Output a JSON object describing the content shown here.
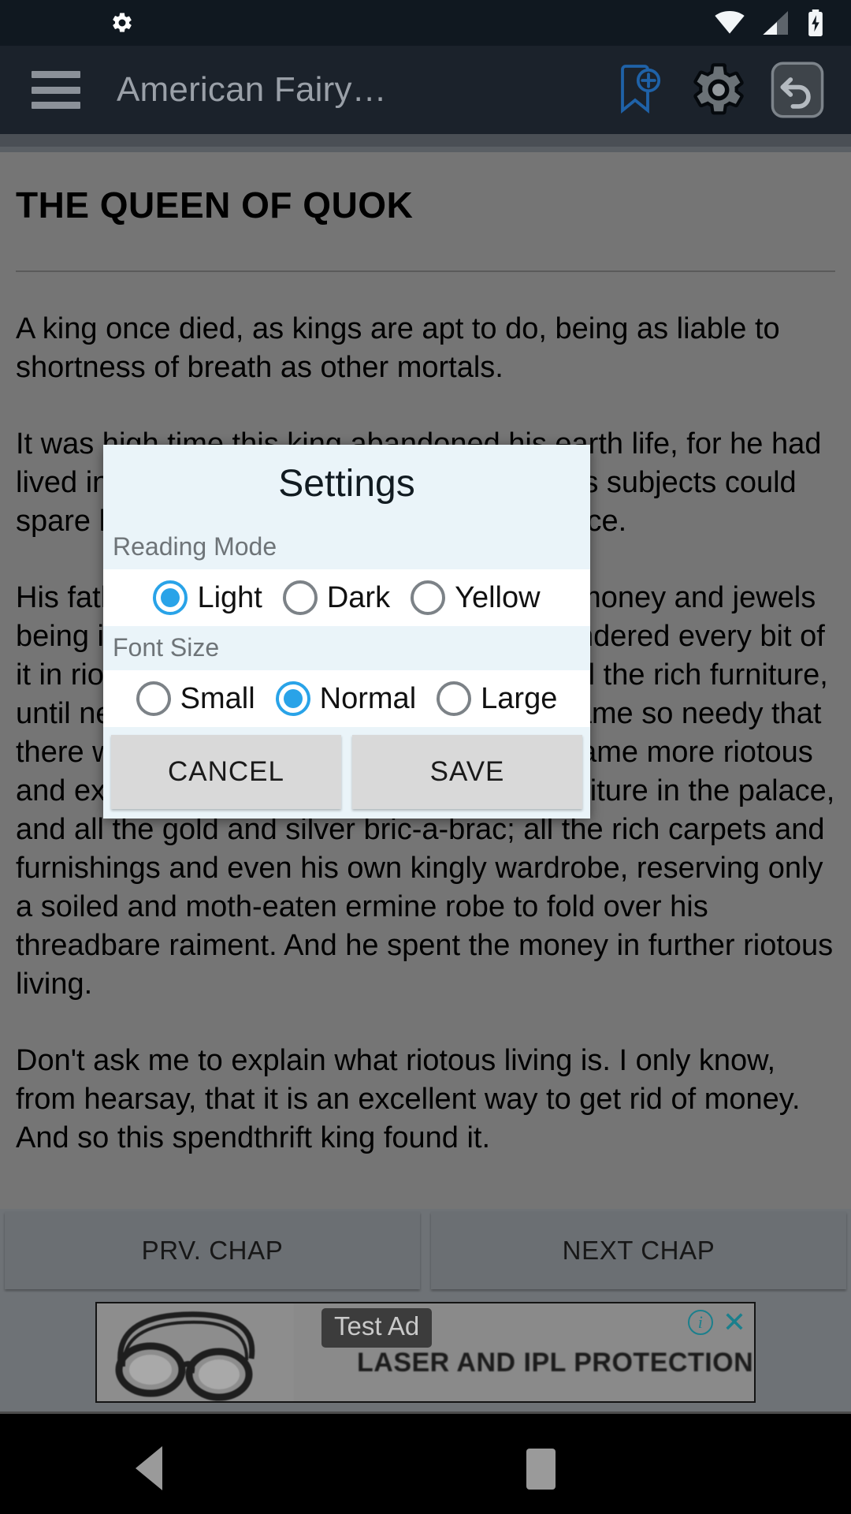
{
  "status_bar": {
    "notification_icon": "gear-icon",
    "icons": [
      "wifi-icon",
      "cellular-signal-icon",
      "battery-charging-icon"
    ]
  },
  "toolbar": {
    "menu_icon": "hamburger-menu-icon",
    "title": "American Fairy…",
    "actions": [
      {
        "name": "add-bookmark-icon",
        "color": "#1f62a8"
      },
      {
        "name": "settings-gear-icon",
        "color": "#5b6166"
      },
      {
        "name": "undo-icon",
        "color": "#9aa0a6"
      }
    ]
  },
  "reader": {
    "chapter_title": "THE QUEEN OF QUOK",
    "paragraphs": [
      "A king once died, as kings are apt to do, being as liable to shortness of breath as other mortals.",
      "It was high time this king abandoned his earth life, for he had lived in a sadly extravagant manner, and his subjects could spare him without the slightest inconvenience.",
      "His father had left him a full treasury, both money and jewels being in abundance. But the son had squandered every bit of it in riotous living. He had then begun to sell the rich furniture, until nearly all was gone. Presently he became so needy that there was nothing more to sell, and he became more riotous and extravagant than ever. He sold the furniture in the palace, and all the gold and silver bric-a-brac; all the rich carpets and furnishings and even his own kingly wardrobe, reserving only a soiled and moth-eaten ermine robe to fold over his threadbare raiment. And he spent the money in further riotous living.",
      "Don't ask me to explain what riotous living is. I only know, from hearsay, that it is an excellent way to get rid of money. And so this spendthrift king found it."
    ]
  },
  "chapter_nav": {
    "prev_label": "PRV. CHAP",
    "next_label": "NEXT CHAP"
  },
  "ad": {
    "badge": "Test Ad",
    "headline": "LASER AND IPL PROTECTION",
    "info_glyph": "i",
    "close_glyph": "✕",
    "image": "swimming-goggles"
  },
  "nav_bar": {
    "back": "back-triangle-icon",
    "recents": "recents-square-icon"
  },
  "settings_dialog": {
    "title": "Settings",
    "sections": [
      {
        "label": "Reading Mode",
        "options": [
          {
            "label": "Light",
            "selected": true
          },
          {
            "label": "Dark",
            "selected": false
          },
          {
            "label": "Yellow",
            "selected": false
          }
        ]
      },
      {
        "label": "Font Size",
        "options": [
          {
            "label": "Small",
            "selected": false
          },
          {
            "label": "Normal",
            "selected": true
          },
          {
            "label": "Large",
            "selected": false
          }
        ]
      }
    ],
    "cancel_label": "CANCEL",
    "save_label": "SAVE",
    "accent_color": "#29a3e8",
    "background_color": "#eaf4f9"
  }
}
